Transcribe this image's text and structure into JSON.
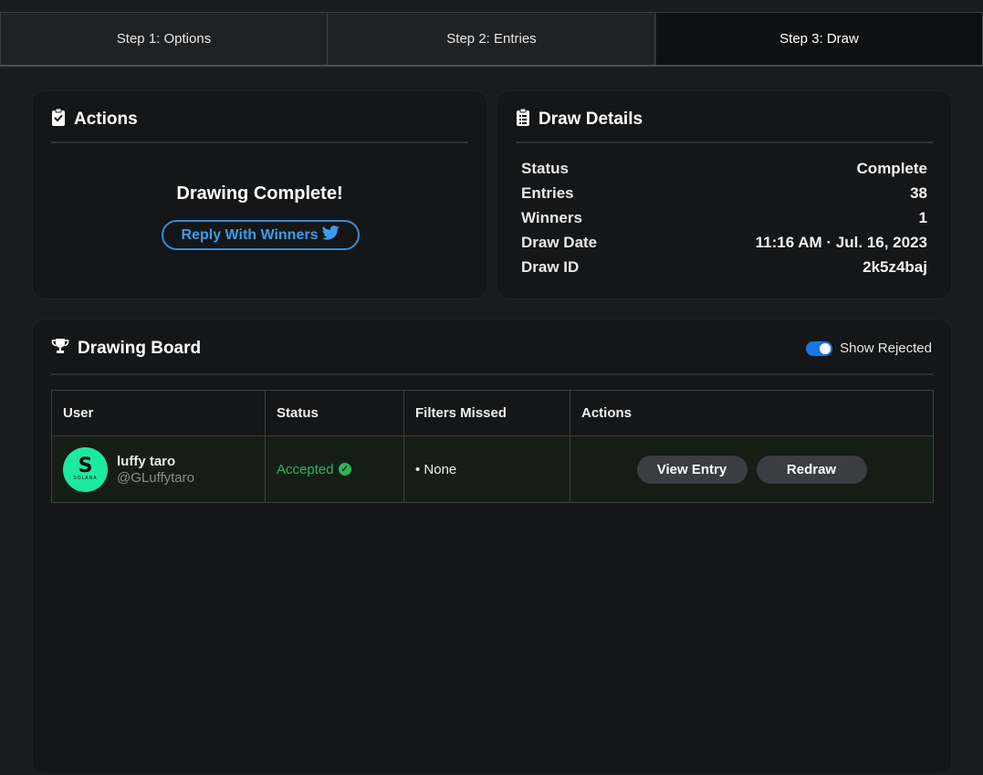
{
  "tabs": [
    {
      "label": "Step 1: Options"
    },
    {
      "label": "Step 2: Entries"
    },
    {
      "label": "Step 3: Draw"
    }
  ],
  "actions": {
    "title": "Actions",
    "message": "Drawing Complete!",
    "reply_button": "Reply With Winners"
  },
  "details": {
    "title": "Draw Details",
    "rows": [
      {
        "label": "Status",
        "value": "Complete"
      },
      {
        "label": "Entries",
        "value": "38"
      },
      {
        "label": "Winners",
        "value": "1"
      },
      {
        "label": "Draw Date",
        "value": "11:16 AM · Jul. 16, 2023"
      },
      {
        "label": "Draw ID",
        "value": "2k5z4baj"
      }
    ]
  },
  "board": {
    "title": "Drawing Board",
    "toggle_label": "Show Rejected",
    "toggle_on": true,
    "columns": [
      "User",
      "Status",
      "Filters Missed",
      "Actions"
    ],
    "rows": [
      {
        "avatar_text": "SOLANA",
        "name": "luffy taro",
        "handle": "@GLuffytaro",
        "status": "Accepted",
        "filters_missed": "• None",
        "view_button": "View Entry",
        "redraw_button": "Redraw"
      }
    ]
  },
  "colors": {
    "accent": "#1677e8",
    "twitter": "#3b9cf0",
    "success": "#2fb35a",
    "avatar_bg": "#1de9a0"
  }
}
